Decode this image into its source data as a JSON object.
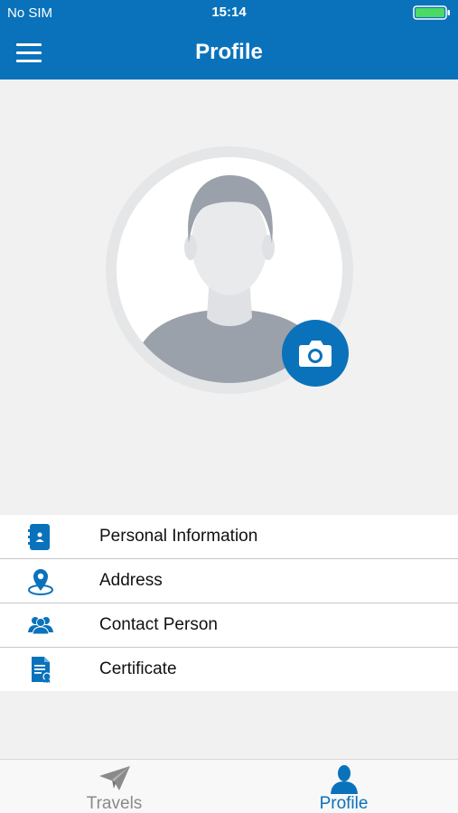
{
  "status_bar": {
    "carrier": "No SIM",
    "time": "15:14"
  },
  "navbar": {
    "title": "Profile"
  },
  "colors": {
    "brand": "#0a72bb",
    "battery": "#4cd964",
    "inactive": "#8a8a8a"
  },
  "menu": [
    {
      "label": "Personal Information",
      "icon": "contact-card-icon"
    },
    {
      "label": "Address",
      "icon": "location-pin-icon"
    },
    {
      "label": "Contact Person",
      "icon": "people-icon"
    },
    {
      "label": "Certificate",
      "icon": "certificate-icon"
    }
  ],
  "tabs": [
    {
      "label": "Travels",
      "icon": "paper-plane-icon",
      "active": false
    },
    {
      "label": "Profile",
      "icon": "person-icon",
      "active": true
    }
  ]
}
